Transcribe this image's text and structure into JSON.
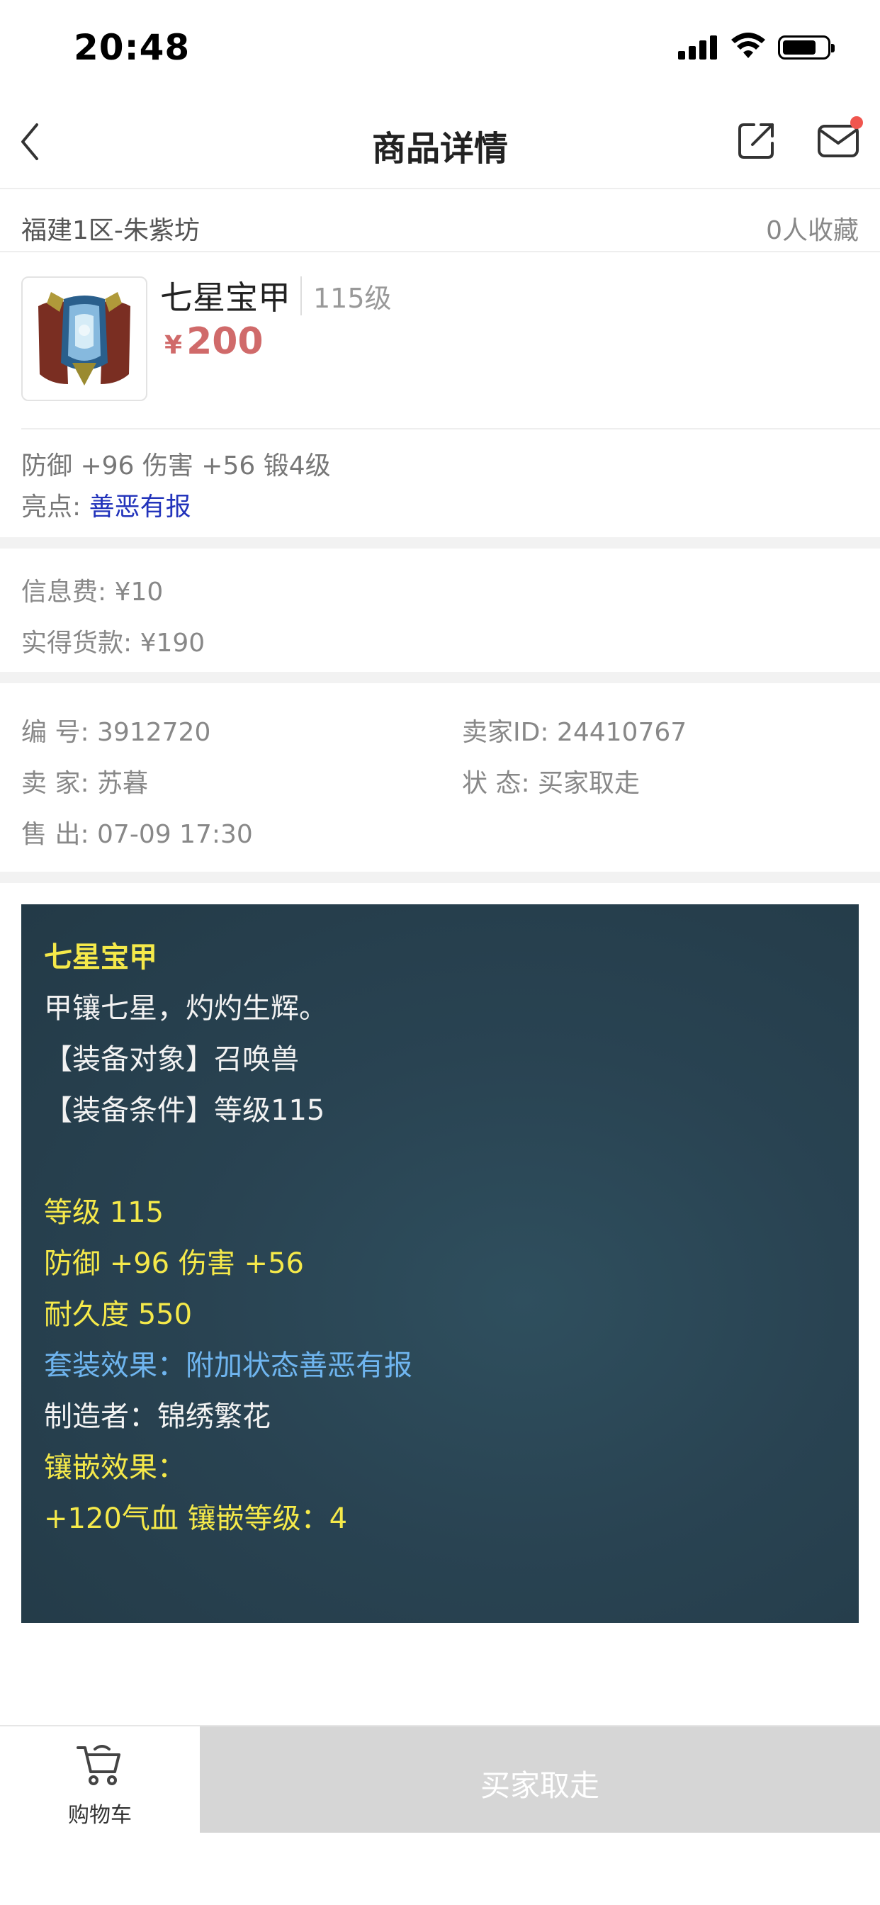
{
  "status_bar": {
    "time": "20:48"
  },
  "nav": {
    "title": "商品详情",
    "icons": [
      "back-icon",
      "share-icon",
      "mail-icon"
    ]
  },
  "server": {
    "name": "福建1区-朱紫坊",
    "favorites": "0人收藏"
  },
  "item": {
    "name": "七星宝甲",
    "level": "115级",
    "price_symbol": "¥",
    "price": "200",
    "stats": "防御 +96 伤害 +56 锻4级",
    "highlight_label": "亮点:",
    "highlight_value": "善恶有报"
  },
  "fees": {
    "info_fee": "信息费: ¥10",
    "net_proceeds": "实得货款: ¥190"
  },
  "details": {
    "number_label": "编 号:",
    "number_value": "3912720",
    "seller_id_label": "卖家ID:",
    "seller_id_value": "24410767",
    "seller_label": "卖 家:",
    "seller_value": "苏暮",
    "status_label": "状 态:",
    "status_value": "买家取走",
    "sold_label": "售 出:",
    "sold_value": "07-09 17:30"
  },
  "description": {
    "title": "七星宝甲",
    "flavor": "甲镶七星，灼灼生辉。",
    "target": "【装备对象】召唤兽",
    "requirement": "【装备条件】等级115",
    "level": "等级 115",
    "stats": "防御 +96 伤害 +56",
    "durability": "耐久度 550",
    "set_effect": "套装效果：附加状态善恶有报",
    "maker": "制造者：锦绣繁花",
    "inlay_title": "镶嵌效果：",
    "inlay_value": "+120气血 镶嵌等级：4"
  },
  "colors": {
    "price": "#d06a6a",
    "highlight": "#2233bb",
    "desc_yellow": "#f5e94a",
    "desc_blue": "#6fb5ef",
    "desc_bg": "#294352",
    "disabled_button": "#d6d6d6"
  },
  "bottom_bar": {
    "cart_label": "购物车",
    "action_label": "买家取走"
  }
}
